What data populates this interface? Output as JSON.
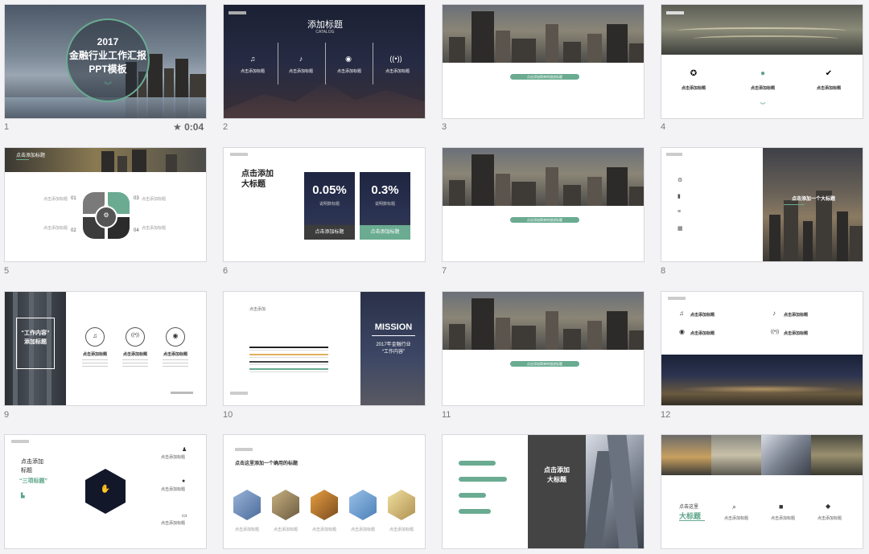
{
  "timer": "0:04",
  "colors": {
    "accent": "#5aa487",
    "dark": "#3c3c3c"
  },
  "slides": [
    {
      "num": "1",
      "title": "2017\n金融行业工作汇报\nPPT模板"
    },
    {
      "num": "2",
      "title": "添加标题",
      "subtitle": "CATALOG",
      "items": [
        "点击添加标题",
        "点击添加标题",
        "点击添加标题",
        "点击添加标题"
      ]
    },
    {
      "num": "3",
      "pill": "点击添加简单的描述标题"
    },
    {
      "num": "4",
      "items": [
        "点击添加标题",
        "点击添加标题",
        "点击添加标题"
      ]
    },
    {
      "num": "5",
      "title": "点击添加标题",
      "labels": [
        "点击添加标题",
        "点击添加标题",
        "点击添加标题",
        "点击添加标题"
      ],
      "nums": [
        "01",
        "02",
        "03",
        "04"
      ]
    },
    {
      "num": "6",
      "title": "点击添加\n大标题",
      "stat1": "0.05%",
      "stat1_label": "说明数标题",
      "stat2": "0.3%",
      "stat2_label": "说明数标题",
      "btn1": "点击添加标题",
      "btn2": "点击添加标题"
    },
    {
      "num": "7",
      "pill": "点击添加简单的描述标题"
    },
    {
      "num": "8",
      "title": "点击添加一个大标题"
    },
    {
      "num": "9",
      "title": "“工作内容”\n添加标题",
      "items": [
        "点击添加标题",
        "点击添加标题",
        "点击添加标题"
      ]
    },
    {
      "num": "10",
      "label": "点击添加",
      "title": "MISSION",
      "subtitle": "2017年金融行业\n“工作内容”"
    },
    {
      "num": "11",
      "pill": "点击添加简单的描述标题"
    },
    {
      "num": "12",
      "items": [
        "点击添加标题",
        "点击添加标题",
        "点击添加标题",
        "点击添加标题"
      ]
    },
    {
      "num": "13",
      "title": "点击添加\n标题",
      "highlight": "“三项标题”",
      "items": [
        "点击添加标题",
        "点击添加标题",
        "点击添加标题"
      ]
    },
    {
      "num": "14",
      "title": "点击这里添加一个确用的标题",
      "items": [
        "点击添加标题",
        "点击添加标题",
        "点击添加标题",
        "点击添加标题",
        "点击添加标题"
      ]
    },
    {
      "num": "15",
      "title": "点击添加\n大标题"
    },
    {
      "num": "16",
      "label": "点击这里",
      "title": "大标题",
      "items": [
        "点击添加标题",
        "点击添加标题",
        "点击添加标题"
      ]
    }
  ]
}
